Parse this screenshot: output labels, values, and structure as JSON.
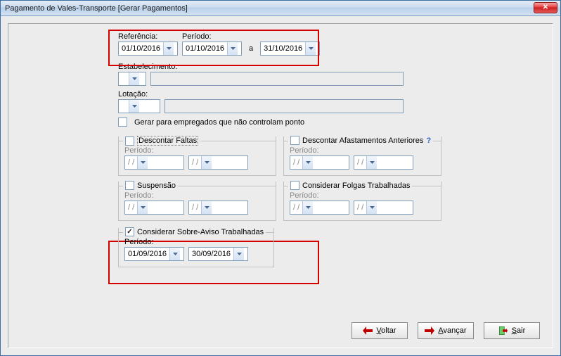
{
  "window": {
    "title": "Pagamento de Vales-Transporte [Gerar Pagamentos]"
  },
  "labels": {
    "referencia": "Referência:",
    "periodo": "Período:",
    "a": "a",
    "estabelecimento": "Estabelecimento:",
    "lotacao": "Lotação:",
    "gerarPara": "Gerar para empregados que não controlam ponto",
    "descontarFaltas": "Descontar Faltas",
    "descontarAfast": "Descontar Afastamentos Anteriores",
    "suspensao": "Suspensão",
    "considerarFolgas": "Considerar Folgas Trabalhadas",
    "considerarSobreAviso": "Considerar Sobre-Aviso Trabalhadas",
    "blankDate": "  /  /",
    "help": "?"
  },
  "values": {
    "referencia": "01/10/2016",
    "periodoStart": "01/10/2016",
    "periodoEnd": "31/10/2016",
    "sobreAvisoStart": "01/09/2016",
    "sobreAvisoEnd": "30/09/2016"
  },
  "buttons": {
    "voltar": "Voltar",
    "avancar": "Avançar",
    "sair": "Sair"
  }
}
